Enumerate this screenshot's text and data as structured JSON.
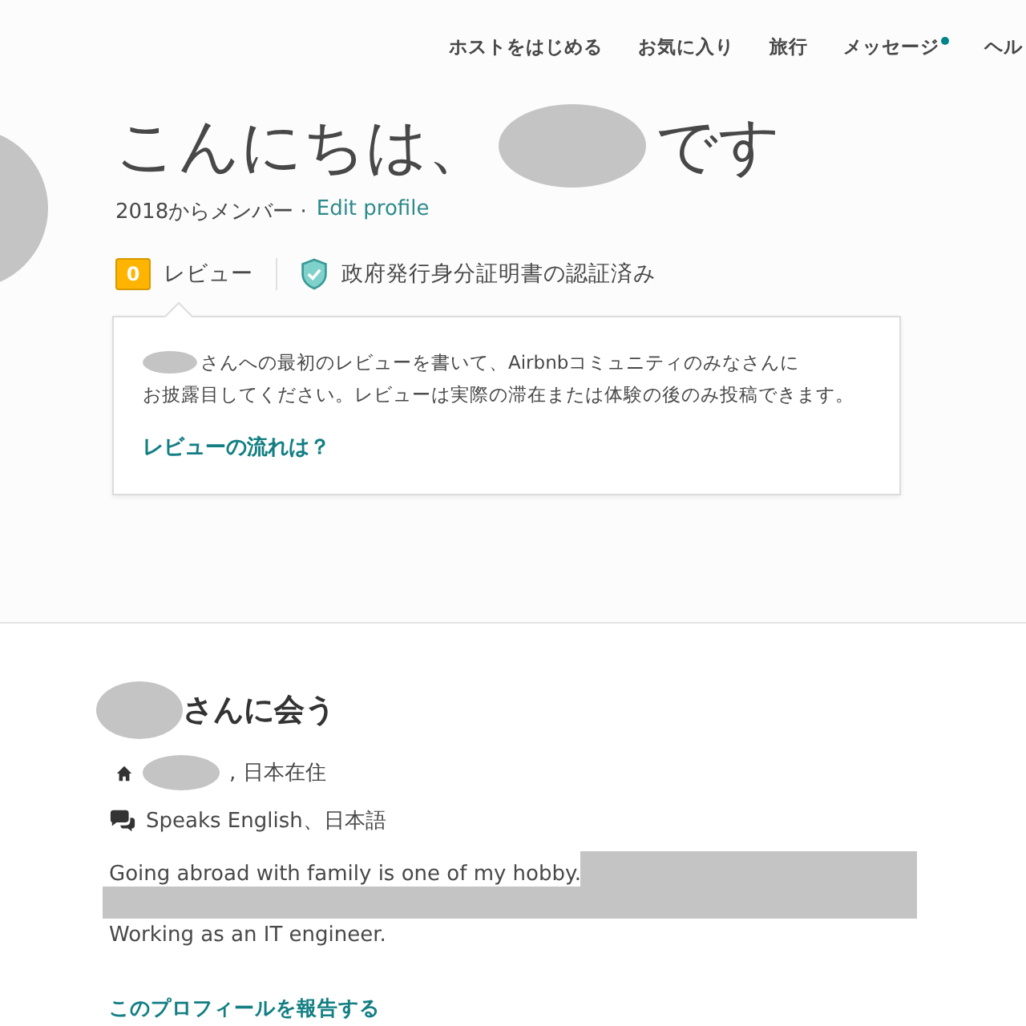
{
  "nav": [
    {
      "label": "ホストをはじめる",
      "unread": false
    },
    {
      "label": "お気に入り",
      "unread": false
    },
    {
      "label": "旅行",
      "unread": false
    },
    {
      "label": "メッセージ",
      "unread": true
    },
    {
      "label": "ヘル",
      "unread": false
    }
  ],
  "greeting": {
    "before": "こんにちは、",
    "after": "です"
  },
  "member_since": "2018からメンバー ·",
  "edit_link": "Edit profile",
  "reviews": {
    "count": "0",
    "label": "レビュー"
  },
  "verification": "政府発行身分証明書の認証済み",
  "review_prompt": {
    "text": [
      "さんへの最初のレビューを書いて、Airbnbコミュニティのみなさんに",
      "お披露目してください。レビューは実際の滞在または体験の後のみ投稿できます。"
    ],
    "link": "レビューの流れは？"
  },
  "about": {
    "heading": "さんに会う",
    "location": ", 日本在住",
    "languages": "Speaks English、日本語",
    "bio": [
      "Going abroad with family is one of my hobby.",
      "Working as an IT engineer."
    ],
    "report_link": "このプロフィールを報告する"
  }
}
